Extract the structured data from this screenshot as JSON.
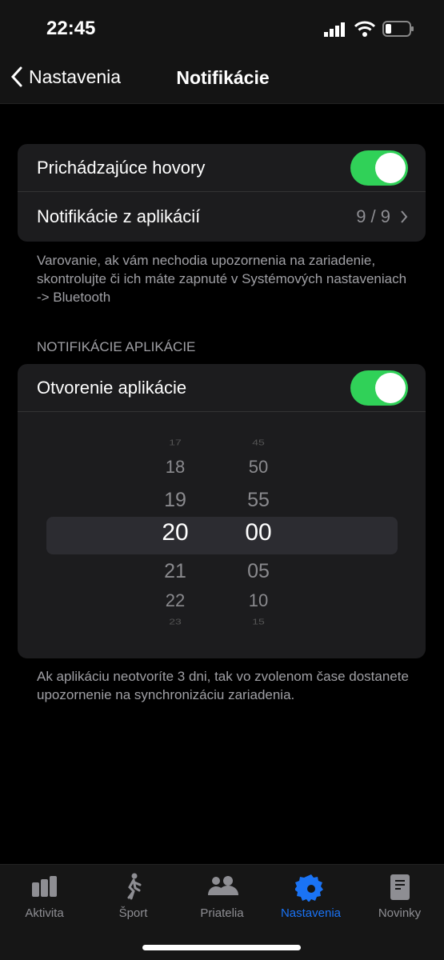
{
  "status": {
    "time": "22:45"
  },
  "nav": {
    "back_label": "Nastavenia",
    "title": "Notifikácie"
  },
  "general": {
    "incoming_calls": {
      "label": "Prichádzajúce hovory",
      "enabled": true
    },
    "app_notifications": {
      "label": "Notifikácie z aplikácií",
      "value": "9 / 9"
    },
    "footnote": "Varovanie, ak vám nechodia upozornenia na zariadenie, skontrolujte či ich máte zapnuté v Systémových nastaveniach -> Bluetooth"
  },
  "app_section": {
    "header": "NOTIFIKÁCIE APLIKÁCIE",
    "app_open": {
      "label": "Otvorenie aplikácie",
      "enabled": true
    },
    "picker": {
      "hours": [
        "17",
        "18",
        "19",
        "20",
        "21",
        "22",
        "23"
      ],
      "minutes": [
        "45",
        "50",
        "55",
        "00",
        "05",
        "10",
        "15"
      ],
      "selected_hour": "20",
      "selected_minute": "00"
    },
    "footnote": "Ak aplikáciu neotvoríte 3 dni, tak vo zvolenom čase dostanete upozornenie na synchronizáciu zariadenia."
  },
  "tabs": [
    {
      "label": "Aktivita",
      "icon": "bar-chart-icon"
    },
    {
      "label": "Šport",
      "icon": "walking-icon"
    },
    {
      "label": "Priatelia",
      "icon": "people-icon"
    },
    {
      "label": "Nastavenia",
      "icon": "gear-icon",
      "active": true
    },
    {
      "label": "Novinky",
      "icon": "document-icon"
    }
  ],
  "colors": {
    "accent": "#1a73f5",
    "toggle_on": "#30d158"
  }
}
